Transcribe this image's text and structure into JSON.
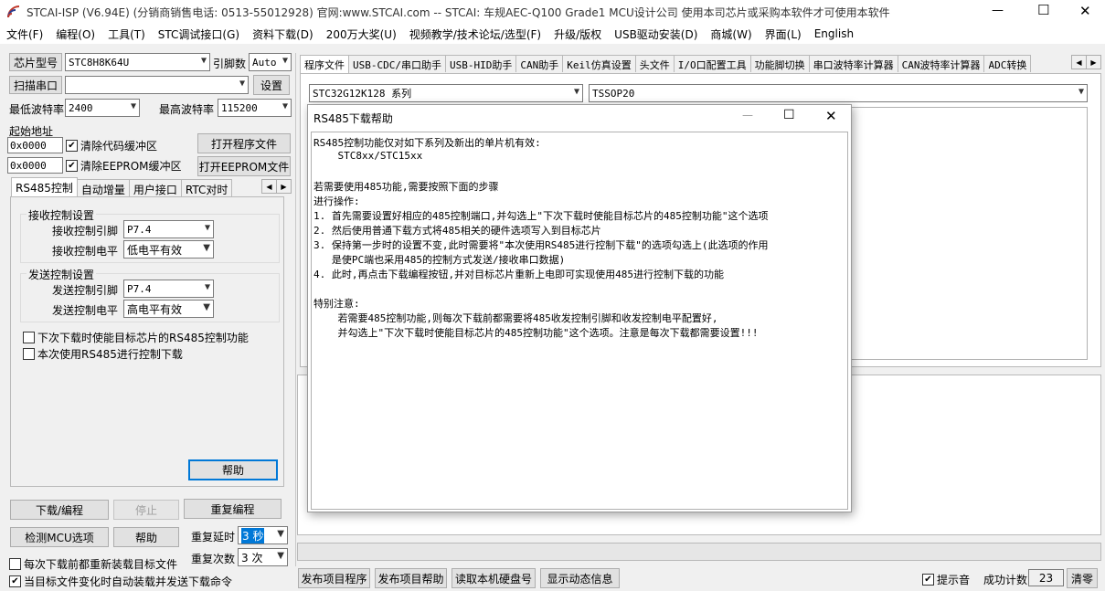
{
  "titlebar": {
    "title": "STCAI-ISP (V6.94E) (分销商销售电话: 0513-55012928) 官网:www.STCAI.com  -- STCAI: 车规AEC-Q100 Grade1 MCU设计公司 使用本司芯片或采购本软件才可使用本软件",
    "minimize": "—",
    "maximize": "☐",
    "close": "✕"
  },
  "menu": [
    "文件(F)",
    "编程(O)",
    "工具(T)",
    "STC调试接口(G)",
    "资料下载(D)",
    "200万大奖(U)",
    "视频教学/技术论坛/选型(F)",
    "升级/版权",
    "USB驱动安装(D)",
    "商城(W)",
    "界面(L)",
    "English"
  ],
  "left": {
    "chip_type_label": "芯片型号",
    "chip_type_value": "STC8H8K64U",
    "pin_count_label": "引脚数",
    "pin_count_value": "Auto",
    "scan_port_label": "扫描串口",
    "port_value": "",
    "settings_label": "设置",
    "min_baud_label": "最低波特率",
    "min_baud_value": "2400",
    "max_baud_label": "最高波特率",
    "max_baud_value": "115200",
    "start_addr_label": "起始地址",
    "code_addr_value": "0x0000",
    "clear_code_label": "清除代码缓冲区",
    "open_program_label": "打开程序文件",
    "eeprom_addr_value": "0x0000",
    "clear_eeprom_label": "清除EEPROM缓冲区",
    "open_eeprom_label": "打开EEPROM文件",
    "tabs": [
      "RS485控制",
      "自动增量",
      "用户接口",
      "RTC对时"
    ],
    "recv_group_title": "接收控制设置",
    "recv_pin_label": "接收控制引脚",
    "recv_pin_value": "P7.4",
    "recv_level_label": "接收控制电平",
    "recv_level_value": "低电平有效",
    "send_group_title": "发送控制设置",
    "send_pin_label": "发送控制引脚",
    "send_pin_value": "P7.4",
    "send_level_label": "发送控制电平",
    "send_level_value": "高电平有效",
    "enable_next_label": "下次下载时使能目标芯片的RS485控制功能",
    "use_this_label": "本次使用RS485进行控制下载",
    "help_label": "帮助",
    "download_label": "下载/编程",
    "stop_label": "停止",
    "reprogram_label": "重复编程",
    "check_mcu_label": "检测MCU选项",
    "help2_label": "帮助",
    "repeat_delay_label": "重复延时",
    "repeat_delay_value": "3 秒",
    "repeat_count_label": "重复次数",
    "repeat_count_value": "3 次",
    "reload_label": "每次下载前都重新装载目标文件",
    "auto_send_label": "当目标文件变化时自动装载并发送下载命令"
  },
  "right": {
    "tabs": [
      "程序文件",
      "USB-CDC/串口助手",
      "USB-HID助手",
      "CAN助手",
      "Keil仿真设置",
      "头文件",
      "I/O口配置工具",
      "功能脚切换",
      "串口波特率计算器",
      "CAN波特率计算器",
      "ADC转换"
    ],
    "series_value": "STC32G12K128 系列",
    "package_value": "TSSOP20"
  },
  "dialog": {
    "title": "RS485下载帮助",
    "lines": [
      "RS485控制功能仅对如下系列及新出的单片机有效:",
      "    STC8xx/STC15xx",
      "",
      "若需要使用485功能,需要按照下面的步骤",
      "进行操作:",
      "1. 首先需要设置好相应的485控制端口,并勾选上\"下次下载时使能目标芯片的485控制功能\"这个选项",
      "2. 然后使用普通下载方式将485相关的硬件选项写入到目标芯片",
      "3. 保持第一步时的设置不变,此时需要将\"本次使用RS485进行控制下载\"的选项勾选上(此选项的作用",
      "   是使PC端也采用485的控制方式发送/接收串口数据)",
      "4. 此时,再点击下载编程按钮,并对目标芯片重新上电即可实现使用485进行控制下载的功能",
      "",
      "特别注意:",
      "    若需要485控制功能,则每次下载前都需要将485收发控制引脚和收发控制电平配置好,",
      "    并勾选上\"下次下载时使能目标芯片的485控制功能\"这个选项。注意是每次下载都需要设置!!!"
    ]
  },
  "bottom": {
    "publish_program": "发布项目程序",
    "publish_help": "发布项目帮助",
    "read_disk": "读取本机硬盘号",
    "show_dynamic": "显示动态信息",
    "beep_label": "提示音",
    "success_count_label": "成功计数",
    "success_count_value": "23",
    "clear_label": "清零"
  }
}
